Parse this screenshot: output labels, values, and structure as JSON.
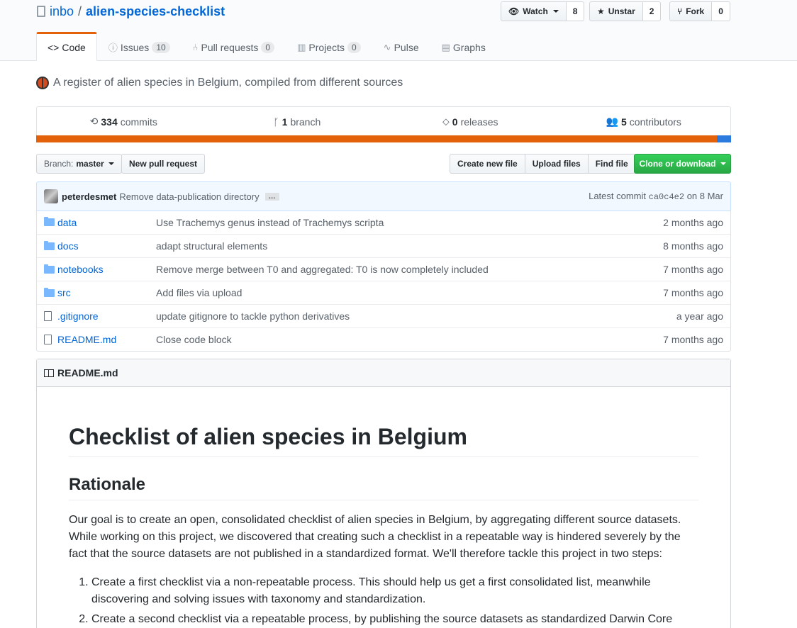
{
  "repo": {
    "owner": "inbo",
    "separator": "/",
    "name": "alien-species-checklist"
  },
  "actions": {
    "watch_label": "Watch",
    "watch_count": "8",
    "star_label": "Unstar",
    "star_count": "2",
    "fork_label": "Fork",
    "fork_count": "0"
  },
  "tabs": [
    {
      "label": "Code",
      "icon": "code-icon"
    },
    {
      "label": "Issues",
      "count": "10",
      "icon": "issue-icon"
    },
    {
      "label": "Pull requests",
      "count": "0",
      "icon": "pull-request-icon"
    },
    {
      "label": "Projects",
      "count": "0",
      "icon": "project-icon"
    },
    {
      "label": "Pulse",
      "icon": "pulse-icon"
    },
    {
      "label": "Graphs",
      "icon": "graph-icon"
    }
  ],
  "description": "A register of alien species in Belgium, compiled from different sources",
  "summary": {
    "commits_count": "334",
    "commits_label": "commits",
    "branch_count": "1",
    "branch_label": "branch",
    "releases_count": "0",
    "releases_label": "releases",
    "contributors_count": "5",
    "contributors_label": "contributors"
  },
  "language_colors": [
    "#e36209",
    "#2b7bde"
  ],
  "file_nav": {
    "branch_prefix": "Branch:",
    "branch_name": "master",
    "new_pull_request": "New pull request",
    "create_new_file": "Create new file",
    "upload_files": "Upload files",
    "find_file": "Find file",
    "clone_or_download": "Clone or download"
  },
  "latest_commit": {
    "author": "peterdesmet",
    "message": "Remove data-publication directory",
    "ellipsis": "…",
    "label": "Latest commit",
    "sha": "ca0c4e2",
    "date": "on 8 Mar"
  },
  "files": [
    {
      "type": "dir",
      "name": "data",
      "message": "Use Trachemys genus instead of Trachemys scripta",
      "age": "2 months ago"
    },
    {
      "type": "dir",
      "name": "docs",
      "message": "adapt structural elements",
      "age": "8 months ago"
    },
    {
      "type": "dir",
      "name": "notebooks",
      "message": "Remove merge between T0 and aggregated: T0 is now completely included",
      "age": "7 months ago"
    },
    {
      "type": "dir",
      "name": "src",
      "message": "Add files via upload",
      "age": "7 months ago"
    },
    {
      "type": "file",
      "name": ".gitignore",
      "message": "update gitignore to tackle python derivatives",
      "age": "a year ago"
    },
    {
      "type": "file",
      "name": "README.md",
      "message": "Close code block",
      "age": "7 months ago"
    }
  ],
  "readme": {
    "filename": "README.md",
    "h1": "Checklist of alien species in Belgium",
    "h2": "Rationale",
    "paragraph": "Our goal is to create an open, consolidated checklist of alien species in Belgium, by aggregating different source datasets. While working on this project, we discovered that creating such a checklist in a repeatable way is hindered severely by the fact that the source datasets are not published in a standardized format. We'll therefore tackle this project in two steps:",
    "steps": [
      "Create a first checklist via a non-repeatable process. This should help us get a first consolidated list, meanwhile discovering and solving issues with taxonomy and standardization.",
      "Create a second checklist via a repeatable process, by publishing the source datasets as standardized Darwin Core"
    ]
  }
}
